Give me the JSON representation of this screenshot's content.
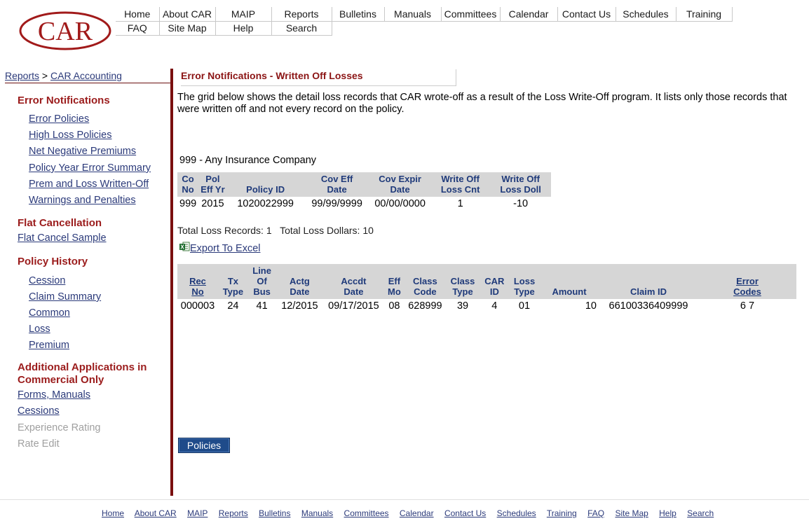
{
  "logo": {
    "text": "CAR"
  },
  "topnav": {
    "row1": [
      "Home",
      "About CAR",
      "MAIP",
      "Reports",
      "Bulletins",
      "Manuals",
      "Committees",
      "Calendar",
      "Contact Us",
      "Schedules",
      "Training"
    ],
    "row2": [
      "FAQ",
      "Site Map",
      "Help",
      "Search"
    ]
  },
  "breadcrumb": {
    "reports": "Reports",
    "sep": " > ",
    "current": "CAR Accounting"
  },
  "sidebar": {
    "error_notifications": {
      "heading": "Error Notifications",
      "items": [
        "Error Policies",
        "High Loss Policies",
        "Net Negative Premiums",
        "Policy Year Error Summary",
        "Prem and Loss Written-Off",
        "Warnings and Penalties"
      ]
    },
    "flat_cancellation": {
      "heading": "Flat Cancellation",
      "items": [
        "Flat Cancel Sample"
      ]
    },
    "policy_history": {
      "heading": "Policy History",
      "items": [
        "Cession",
        "Claim Summary",
        "Common",
        "Loss",
        "Premium"
      ]
    },
    "additional": {
      "heading_line1": "Additional Applications in",
      "heading_line2": "Commercial Only",
      "items": [
        "Forms, Manuals",
        "Cessions"
      ],
      "disabled_items": [
        "Experience Rating",
        "Rate Edit"
      ]
    }
  },
  "main": {
    "title": "Error Notifications - Written Off Losses",
    "description": "The grid below shows the detail loss records that CAR wrote-off as a result of the Loss Write-Off program.  It lists only those records that were written off and not every record on the policy.",
    "company": "999 - Any Insurance Company",
    "policy_grid": {
      "headers": [
        [
          "Co",
          "No"
        ],
        [
          "Pol",
          "Eff Yr"
        ],
        [
          "Policy ID"
        ],
        [
          "Cov Eff",
          "Date"
        ],
        [
          "Cov Expir",
          "Date"
        ],
        [
          "Write Off",
          "Loss Cnt"
        ],
        [
          "Write Off",
          "Loss Doll"
        ]
      ],
      "rows": [
        [
          "999",
          "2015",
          "1020022999",
          "99/99/9999",
          "00/00/0000",
          "1",
          "-10"
        ]
      ]
    },
    "totals": {
      "records_label": "Total Loss Records:",
      "records_value": "1",
      "dollars_label": "Total Loss Dollars:",
      "dollars_value": "10"
    },
    "export_label": "Export To Excel",
    "loss_grid": {
      "headers": [
        [
          "Rec",
          "No"
        ],
        [
          "Tx",
          "Type"
        ],
        [
          "Line",
          "Of",
          "Bus"
        ],
        [
          "Actg",
          "Date"
        ],
        [
          "Accdt",
          "Date"
        ],
        [
          "Eff",
          "Mo"
        ],
        [
          "Class",
          "Code"
        ],
        [
          "Class",
          "Type"
        ],
        [
          "CAR",
          "ID"
        ],
        [
          "Loss",
          "Type"
        ],
        [
          "Amount"
        ],
        [
          "Claim ID"
        ],
        [
          "Error",
          "Codes"
        ]
      ],
      "rows": [
        [
          "000003",
          "24",
          "41",
          "12/2015",
          "09/17/2015",
          "08",
          "628999",
          "39",
          "4",
          "01",
          "10",
          "66100336409999",
          "6 7"
        ]
      ]
    },
    "policies_button": "Policies"
  },
  "footer": {
    "links": [
      "Home",
      "About CAR",
      "MAIP",
      "Reports",
      "Bulletins",
      "Manuals",
      "Committees",
      "Calendar",
      "Contact Us",
      "Schedules",
      "Training",
      "FAQ",
      "Site Map",
      "Help",
      "Search"
    ]
  },
  "colors": {
    "brand_red": "#8b1414",
    "link_blue": "#2b3a7a",
    "header_gray": "#d6d6d6",
    "button_blue": "#1f4b8a"
  }
}
